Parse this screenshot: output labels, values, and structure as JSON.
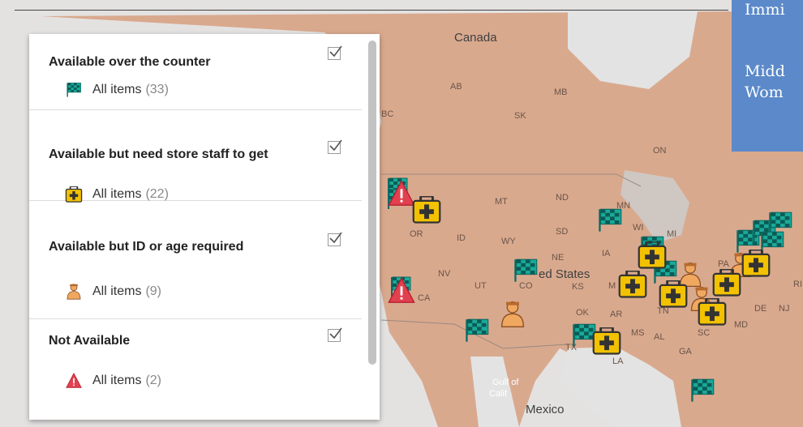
{
  "map": {
    "country_labels": [
      "Canada",
      "ed States",
      "Mexico"
    ],
    "region_labels": [
      "AB",
      "MB",
      "SK",
      "BC",
      "ON",
      "MT",
      "ND",
      "MN",
      "WI",
      "MI",
      "OR",
      "ID",
      "WY",
      "SD",
      "NE",
      "IA",
      "NV",
      "UT",
      "CO",
      "KS",
      "CA",
      "OK",
      "AR",
      "TN",
      "MS",
      "AL",
      "GA",
      "SC",
      "PA",
      "DE",
      "NJ",
      "MD",
      "LA",
      "TX",
      "M",
      "RI"
    ],
    "water_labels": [
      "Gulf of",
      "Calif"
    ]
  },
  "legend": {
    "groups": [
      {
        "title": "Available over the counter",
        "item_label": "All items",
        "count": "(33)",
        "icon": "green-flag-icon"
      },
      {
        "title": "Available but need store staff to get",
        "item_label": "All items",
        "count": "(22)",
        "icon": "yellow-medkit-icon"
      },
      {
        "title": "Available but ID or age required",
        "item_label": "All items",
        "count": "(9)",
        "icon": "orange-clerk-icon"
      },
      {
        "title": "Not Available",
        "item_label": "All items",
        "count": "(2)",
        "icon": "red-warning-icon"
      }
    ]
  },
  "notes": {
    "lines": [
      "Immi",
      "Midd",
      "Wom"
    ]
  },
  "colors": {
    "land": "#dcae93",
    "ocean": "#e3e3e3",
    "flag": "#1aa99a",
    "medkit": "#f2c100",
    "clerk": "#f0a860",
    "warning": "#e2404f",
    "notes_bg": "#5b89c9"
  }
}
